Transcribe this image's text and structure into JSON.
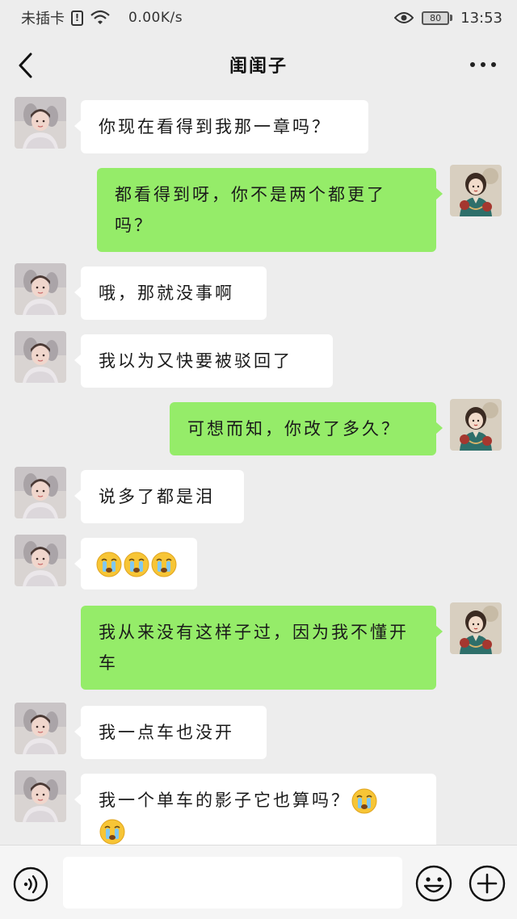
{
  "status_bar": {
    "carrier": "未插卡",
    "speed": "0.00K/s",
    "battery": "80",
    "time": "13:53"
  },
  "header": {
    "title": "闺闺子"
  },
  "messages": [
    {
      "side": "in",
      "text": "你现在看得到我那一章吗？"
    },
    {
      "side": "out",
      "text": "都看得到呀，你不是两个都更了吗？"
    },
    {
      "side": "in",
      "text": "哦，那就没事啊"
    },
    {
      "side": "in",
      "text": "我以为又快要被驳回了"
    },
    {
      "side": "out",
      "text": "可想而知，你改了多久？"
    },
    {
      "side": "in",
      "text": "说多了都是泪"
    },
    {
      "side": "in",
      "emoji": [
        "crying-emoji",
        "crying-emoji",
        "crying-emoji"
      ]
    },
    {
      "side": "out",
      "text": "我从来没有这样子过，因为我不懂开车"
    },
    {
      "side": "in",
      "text": "我一点车也没开"
    },
    {
      "side": "in",
      "text": "我一个单车的影子它也算吗？"
    }
  ],
  "input": {
    "placeholder": ""
  },
  "icons": {
    "back": "back-arrow-icon",
    "more": "more-icon",
    "voice": "voice-icon",
    "emoji": "emoji-icon",
    "plus": "plus-icon"
  },
  "colors": {
    "background": "#ededed",
    "incoming_bubble": "#ffffff",
    "outgoing_bubble": "#95ec69"
  }
}
